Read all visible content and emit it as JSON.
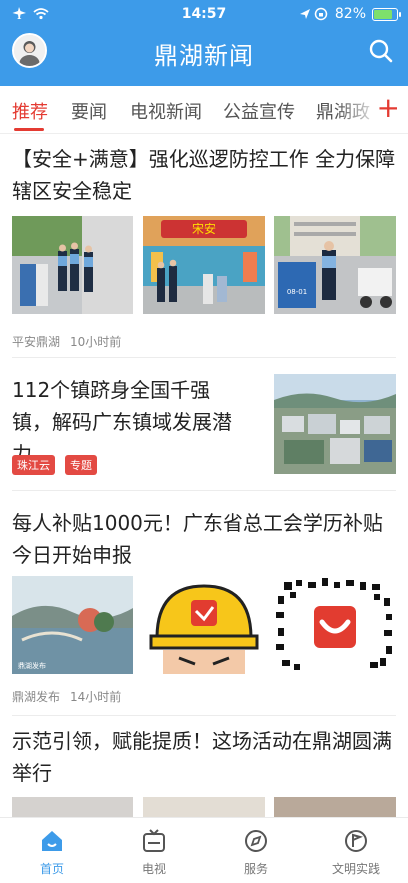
{
  "status_bar": {
    "time": "14:57",
    "battery_percent": "82%",
    "battery_level": 0.82
  },
  "header": {
    "title": "鼎湖新闻",
    "avatar_icon": "user-avatar",
    "search_icon": "search-icon"
  },
  "tabs": [
    {
      "label": "推荐",
      "active": true
    },
    {
      "label": "要闻",
      "active": false
    },
    {
      "label": "电视新闻",
      "active": false
    },
    {
      "label": "公益宣传",
      "active": false
    },
    {
      "label": "鼎湖政",
      "active": false
    }
  ],
  "add_tab_label": "+",
  "articles": [
    {
      "title": "【安全+满意】强化巡逻防控工作 全力保障辖区安全稳定",
      "source": "平安鼎湖",
      "time": "10小时前",
      "tags": []
    },
    {
      "title": "112个镇跻身全国千强镇，解码广东镇域发展潜力",
      "source": "",
      "time": "",
      "tags": [
        "珠江云",
        "专题"
      ]
    },
    {
      "title": "每人补贴1000元！广东省总工会学历补贴今日开始申报",
      "source": "鼎湖发布",
      "time": "14小时前",
      "tags": []
    },
    {
      "title": "示范引领，赋能提质！这场活动在鼎湖圆满举行",
      "source": "",
      "time": "",
      "tags": []
    }
  ],
  "image_text": {
    "board_banner": "宋安",
    "plate_a": "08-01",
    "photo_credit": "鼎湖发布"
  },
  "tabbar": [
    {
      "label": "首页",
      "icon": "home-icon",
      "active": true
    },
    {
      "label": "电视",
      "icon": "tv-icon",
      "active": false
    },
    {
      "label": "服务",
      "icon": "compass-icon",
      "active": false
    },
    {
      "label": "文明实践",
      "icon": "flag-circle-icon",
      "active": false
    }
  ],
  "colors": {
    "brand_blue": "#3d9be9",
    "accent_red": "#e43b32",
    "tag_red": "#e34a43"
  }
}
